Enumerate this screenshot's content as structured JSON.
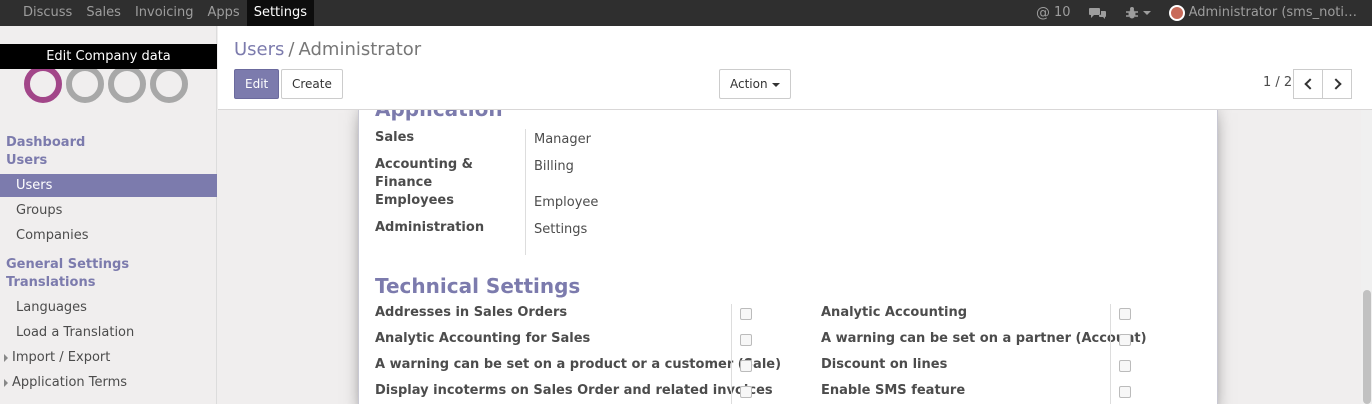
{
  "topbar": {
    "menu": [
      "Discuss",
      "Sales",
      "Invoicing",
      "Apps",
      "Settings"
    ],
    "active_menu": "Settings",
    "mentions_count": "10",
    "user_label": "Administrator (sms_noti…"
  },
  "sidebar": {
    "tooltip": "Edit Company data",
    "sections": [
      {
        "label": "Dashboard"
      },
      {
        "label": "Users"
      },
      {
        "label": "General Settings"
      },
      {
        "label": "Translations"
      }
    ],
    "items": [
      {
        "label": "Users",
        "active": true
      },
      {
        "label": "Groups"
      },
      {
        "label": "Companies"
      },
      {
        "label": "Languages"
      },
      {
        "label": "Load a Translation"
      },
      {
        "label": "Import / Export"
      },
      {
        "label": "Application Terms"
      }
    ],
    "logo_colors": [
      "#a24689",
      "#a8a8a8",
      "#a8a8a8",
      "#a8a8a8"
    ]
  },
  "control_panel": {
    "breadcrumb_parent": "Users",
    "breadcrumb_sep": "/",
    "breadcrumb_current": "Administrator",
    "edit_label": "Edit",
    "create_label": "Create",
    "action_label": "Action",
    "pager": "1 / 2"
  },
  "form": {
    "application_title": "Application",
    "applications": [
      {
        "label": "Sales",
        "value": "Manager"
      },
      {
        "label": "Accounting & Finance",
        "value": "Billing"
      },
      {
        "label": "Employees",
        "value": "Employee"
      },
      {
        "label": "Administration",
        "value": "Settings"
      }
    ],
    "technical_title": "Technical Settings",
    "technical_left": [
      "Addresses in Sales Orders",
      "Analytic Accounting for Sales",
      "A warning can be set on a product or a customer (Sale)",
      "Display incoterms on Sales Order and related invoices"
    ],
    "technical_right": [
      "Analytic Accounting",
      "A warning can be set on a partner (Account)",
      "Discount on lines",
      "Enable SMS feature"
    ]
  },
  "colors": {
    "brand": "#7c7bad",
    "navbar": "#2f2f2f"
  }
}
